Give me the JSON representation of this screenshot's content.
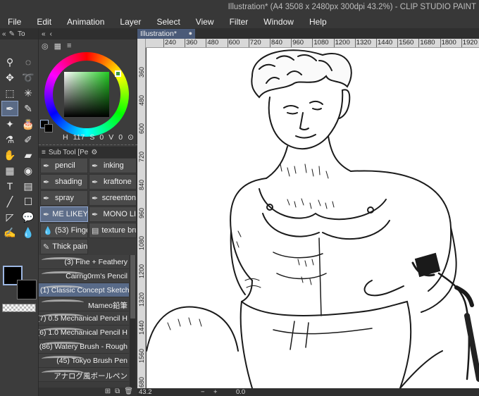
{
  "window": {
    "title": "Illustration* (A4 3508 x 2480px 300dpi 43.2%) - CLIP STUDIO PAINT"
  },
  "menu": [
    "File",
    "Edit",
    "Animation",
    "Layer",
    "Select",
    "View",
    "Filter",
    "Window",
    "Help"
  ],
  "toolbar_head": {
    "tab_label": "To"
  },
  "color_panel": {
    "hsv_h": "117",
    "hsv_s": "0",
    "hsv_v": "0",
    "h_label": "H",
    "s_label": "S",
    "v_label": "V"
  },
  "subtool": {
    "tab_label": "Sub Tool [Pe"
  },
  "categories": [
    {
      "label": "pencil",
      "selected": false
    },
    {
      "label": "inking",
      "selected": false
    },
    {
      "label": "shading",
      "selected": false
    },
    {
      "label": "kraftone",
      "selected": false
    },
    {
      "label": "spray",
      "selected": false
    },
    {
      "label": "screenton",
      "selected": false
    },
    {
      "label": "ME LIKEY",
      "selected": true
    },
    {
      "label": "MONO LI",
      "selected": false
    },
    {
      "label": "(53) Finge",
      "selected": false
    },
    {
      "label": "texture bru",
      "selected": false
    },
    {
      "label": "Thick pain",
      "selected": false
    }
  ],
  "brushes": [
    {
      "label": "(3) Fine + Feathery",
      "selected": false
    },
    {
      "label": "Cairng0rm's Pencil",
      "selected": false
    },
    {
      "label": "(1) Classic Concept Sketche",
      "selected": true
    },
    {
      "label": "Mameo鉛筆",
      "selected": false
    },
    {
      "label": "(7) 0.5 Mechanical Pencil H",
      "selected": false
    },
    {
      "label": "(6) 1.0 Mechanical Pencil H",
      "selected": false
    },
    {
      "label": "(86) Watery Brush - Rough",
      "selected": false
    },
    {
      "label": "(45) Tokyo Brush Pen",
      "selected": false
    },
    {
      "label": "アナログ風ボールペン",
      "selected": false
    }
  ],
  "document": {
    "tab_label": "Illustration*"
  },
  "ruler_h": [
    "240",
    "360",
    "480",
    "600",
    "720",
    "840",
    "960",
    "1080",
    "1200",
    "1320",
    "1440",
    "1560",
    "1680",
    "1800",
    "1920",
    "20"
  ],
  "ruler_v": [
    "360",
    "480",
    "600",
    "720",
    "840",
    "960",
    "1080",
    "1200",
    "1320",
    "1440",
    "1560",
    "1680"
  ],
  "status": {
    "zoom": "43.2",
    "angle": "0.0"
  }
}
